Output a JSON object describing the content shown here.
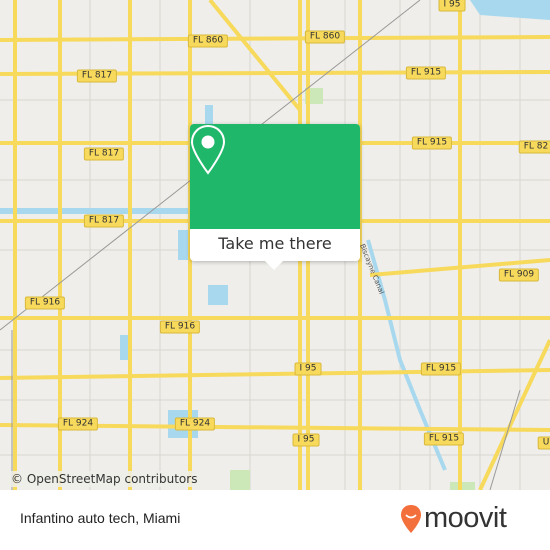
{
  "map": {
    "road_labels": [
      "FL 860",
      "FL 860",
      "I 95",
      "FL 817",
      "FL 915",
      "FL 817",
      "FL 915",
      "FL 82",
      "FL 817",
      "FL 909",
      "FL 916",
      "FL 916",
      "I 95",
      "FL 915",
      "FL 924",
      "FL 924",
      "I 95",
      "FL 915",
      "U"
    ],
    "canal_label": "Biscayne Canal",
    "attribution": "© OpenStreetMap contributors",
    "colors": {
      "land": "#efeeea",
      "road": "#f7d95c",
      "water": "#a8d8ee",
      "park": "#cde8b8",
      "accent": "#1fb86b"
    }
  },
  "popup": {
    "button_label": "Take me there",
    "icon": "location-pin-icon"
  },
  "footer": {
    "place_name": "Infantino auto tech, Miami",
    "brand": "moovit",
    "brand_color": "#f36f3b"
  }
}
